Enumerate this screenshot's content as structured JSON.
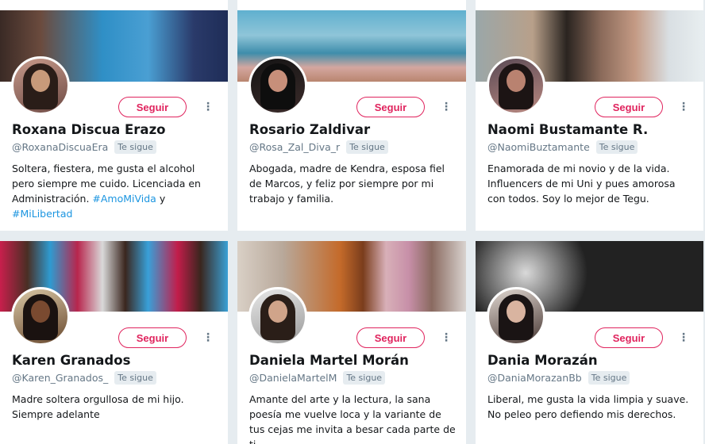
{
  "follow_label": "Seguir",
  "follows_you_label": "Te sigue",
  "more_glyph": "⋮",
  "colors": {
    "accent": "#e0245e",
    "link": "#1b95e0",
    "background": "#e6ecf0"
  },
  "cards": [
    {
      "name": "Roxana Discua Erazo",
      "handle": "@RoxanaDiscuaEra",
      "bio_parts": [
        "Soltera, fiestera, me gusta el alcohol pero siempre me cuido. Licenciada en Administración. ",
        "#AmoMiVida",
        " y ",
        "#MiLibertad"
      ]
    },
    {
      "name": "Rosario Zaldivar",
      "handle": "@Rosa_Zal_Diva_r",
      "bio": "Abogada, madre de Kendra, esposa fiel de Marcos, y feliz por siempre por mi trabajo y familia."
    },
    {
      "name": "Naomi Bustamante R.",
      "handle": "@NaomiBuztamante",
      "bio": "Enamorada de mi novio y de la vida. Influencers de mi Uni y pues amorosa con todos. Soy lo mejor de Tegu."
    },
    {
      "name": "Karen Granados",
      "handle": "@Karen_Granados_",
      "bio": "Madre soltera orgullosa de mi hijo. Siempre adelante"
    },
    {
      "name": "Daniela Martel Morán",
      "handle": "@DanielaMartelM",
      "bio": "Amante del arte y la lectura, la sana poesía me vuelve loca y la variante de tus cejas me invita a besar cada parte de ti."
    },
    {
      "name": "Dania Morazán",
      "handle": "@DaniaMorazanBb",
      "bio": "Liberal, me gusta la vida limpia y suave. No peleo pero defiendo mis derechos."
    }
  ]
}
